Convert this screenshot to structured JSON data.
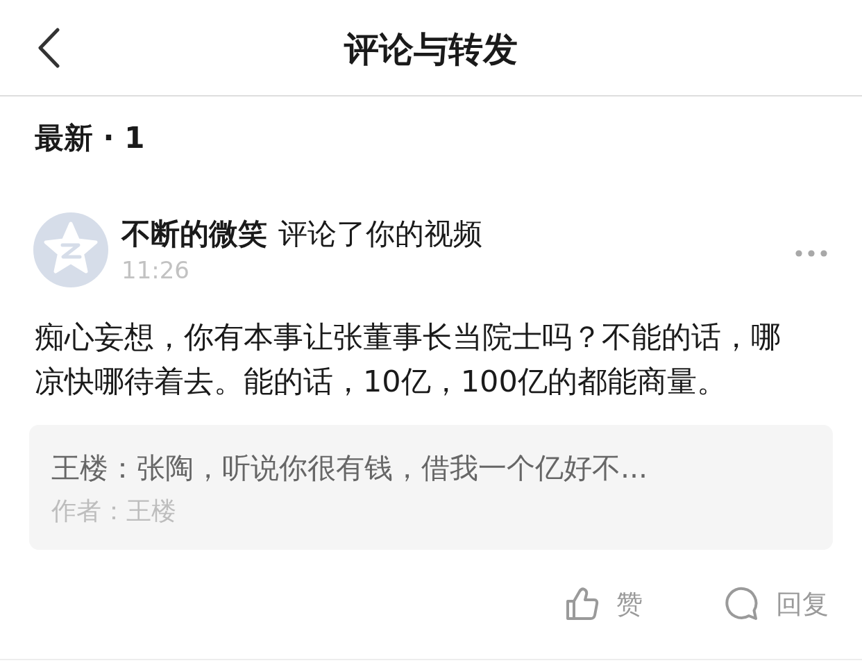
{
  "header": {
    "title": "评论与转发"
  },
  "section": {
    "title": "最新 · 1"
  },
  "comments": [
    {
      "user_name": "不断的微笑",
      "action": "评论了你的视频",
      "time": "11:26",
      "text": "痴心妄想，你有本事让张董事长当院士吗？不能的话，哪凉快哪待着去。能的话，10亿，100亿的都能商量。",
      "quoted": {
        "text": "王楼：张陶，听说你很有钱，借我一个亿好不...",
        "author": "作者：王楼"
      },
      "actions": [
        {
          "kind": "like",
          "label": "赞"
        },
        {
          "kind": "reply",
          "label": "回复"
        }
      ]
    }
  ]
}
